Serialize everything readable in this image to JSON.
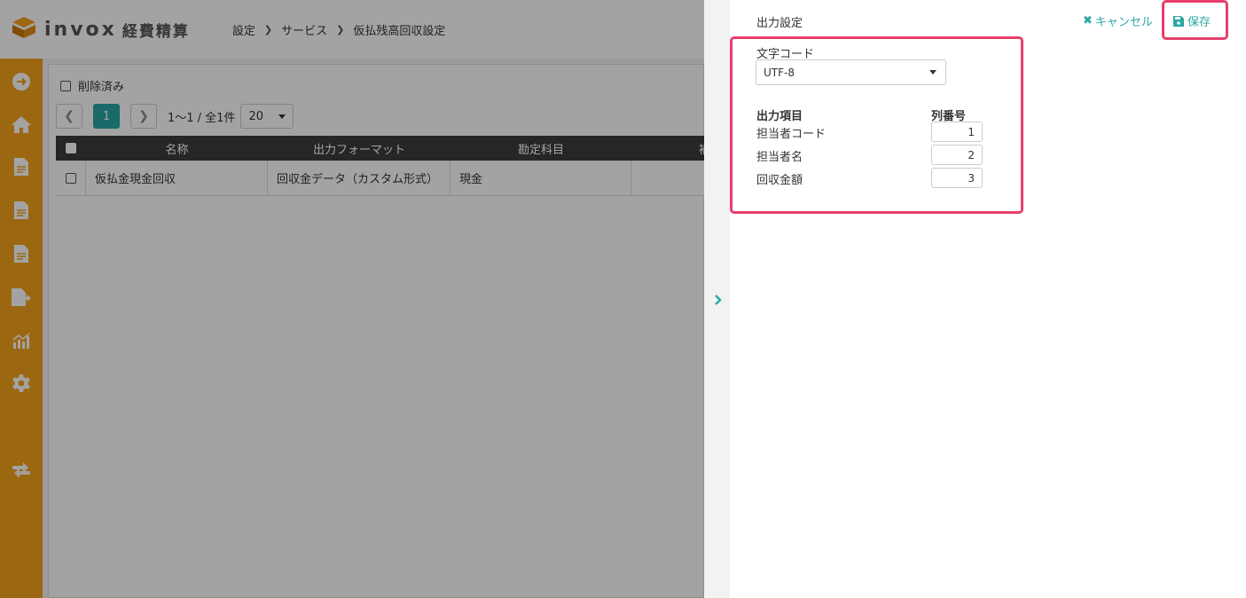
{
  "header": {
    "brand": "invox",
    "product": "経費精算",
    "breadcrumb": [
      "設定",
      "サービス",
      "仮払残高回収設定"
    ]
  },
  "sidenav": {
    "items": [
      "arrow-right-circle-icon",
      "home-icon",
      "document-icon",
      "document-icon",
      "document-icon",
      "document-export-icon",
      "chart-icon",
      "gear-icon",
      "transfer-icon"
    ]
  },
  "list": {
    "deleted_filter_label": "削除済み",
    "pager": {
      "current_page": "1",
      "count_text": "1〜1 / 全1件",
      "per_page": "20"
    },
    "columns": [
      "名称",
      "出力フォーマット",
      "勘定科目",
      "補"
    ],
    "rows": [
      {
        "name": "仮払金現金回収",
        "format": "回収金データ（カスタム形式）",
        "account": "現金",
        "extra": ""
      }
    ]
  },
  "panel": {
    "title": "出力設定",
    "cancel_label": "キャンセル",
    "save_label": "保存",
    "charset_label": "文字コード",
    "charset_value": "UTF-8",
    "items_header": "出力項目",
    "colno_header": "列番号",
    "items": [
      {
        "label": "担当者コード",
        "col": "1"
      },
      {
        "label": "担当者名",
        "col": "2"
      },
      {
        "label": "回収金額",
        "col": "3"
      }
    ]
  },
  "colors": {
    "accent": "#2aa7a4",
    "nav": "#f5a21b",
    "highlight": "#e83e6c"
  }
}
